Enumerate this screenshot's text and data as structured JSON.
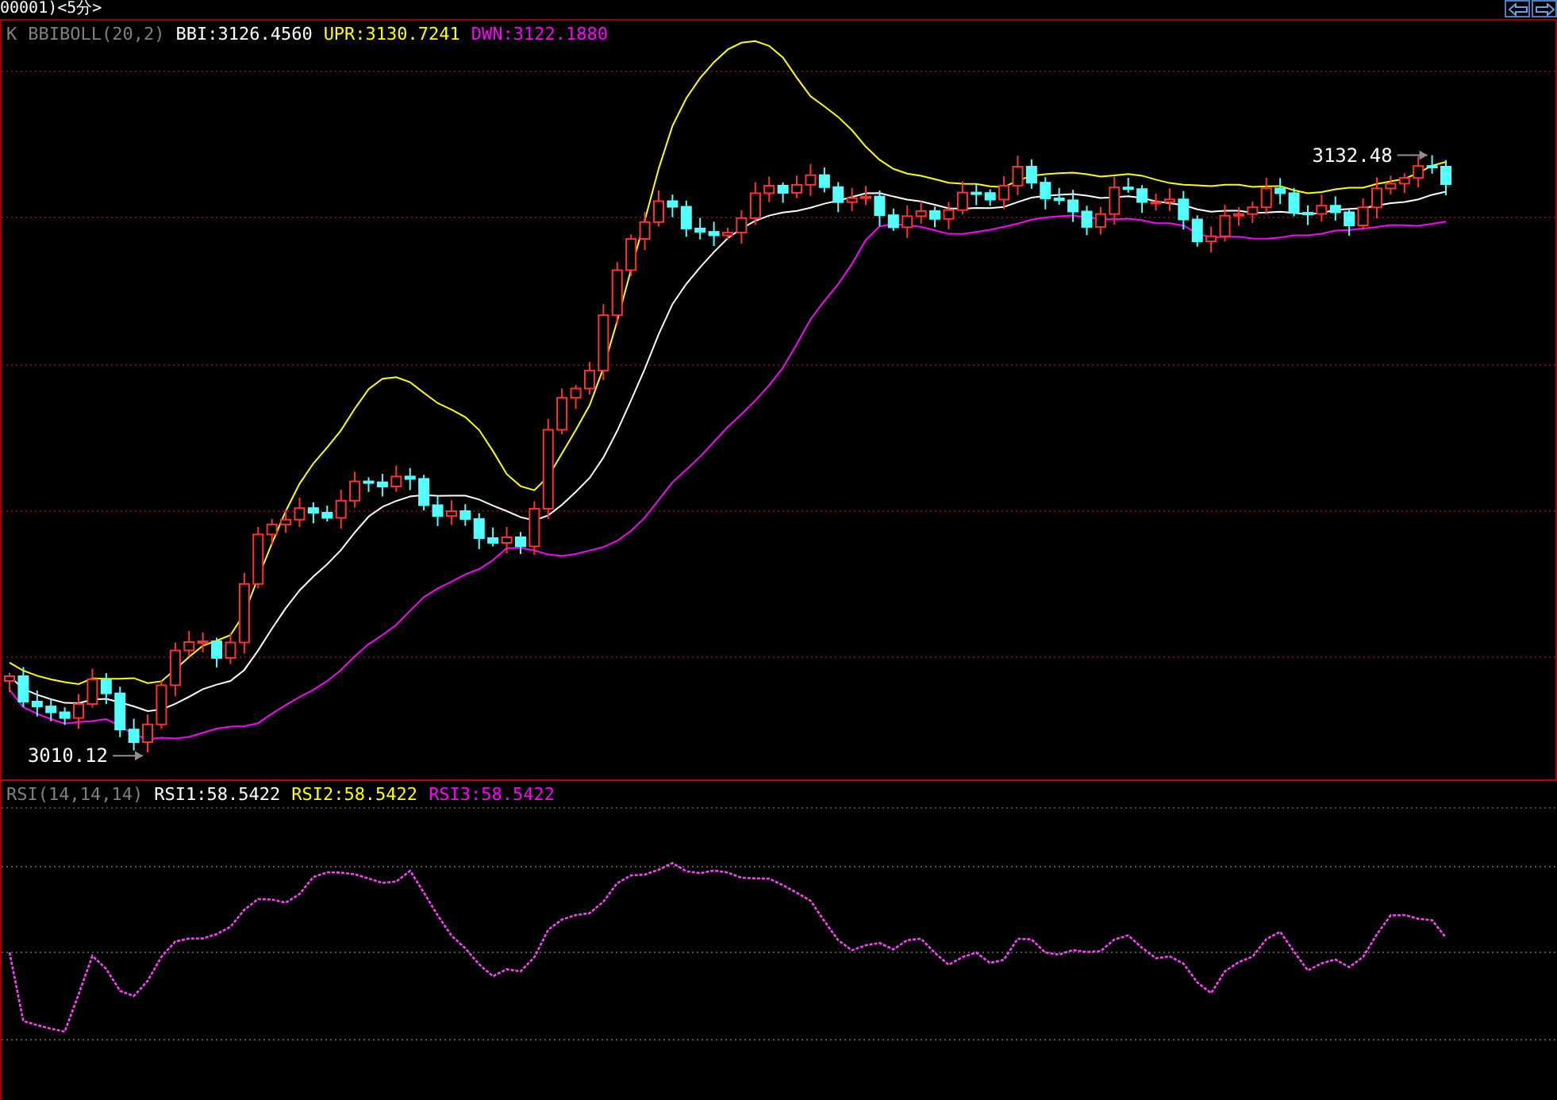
{
  "title_bar": {
    "title": "00001)<5分>",
    "buttons": [
      {
        "kind": "prev"
      },
      {
        "kind": "next"
      }
    ]
  },
  "main_panel": {
    "legend": [
      {
        "text": "K",
        "color": "#808080"
      },
      {
        "text": "BBIBOLL(20,2)",
        "color": "#808080"
      },
      {
        "text": "BBI:3126.4560",
        "color": "#ffffff"
      },
      {
        "text": "UPR:3130.7241",
        "color": "#ffff00"
      },
      {
        "text": "DWN:3122.1880",
        "color": "#ff00ff"
      }
    ],
    "annotations": [
      {
        "kind": "high",
        "text": "3132.48"
      },
      {
        "kind": "low",
        "text": "3010.12"
      }
    ]
  },
  "rsi_panel": {
    "legend": [
      {
        "text": "RSI(14,14,14)",
        "color": "#808080"
      },
      {
        "text": "RSI1:58.5422",
        "color": "#ffffff"
      },
      {
        "text": "RSI2:58.5422",
        "color": "#ffff00"
      },
      {
        "text": "RSI3:58.5422",
        "color": "#ff00ff"
      }
    ]
  }
}
